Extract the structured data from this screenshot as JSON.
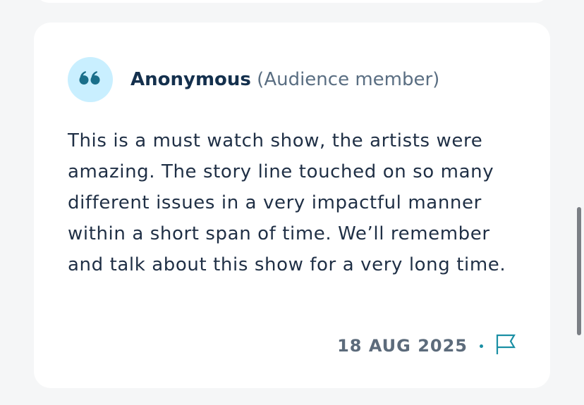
{
  "review": {
    "avatar_icon": "quote-icon",
    "author_name": "Anonymous",
    "author_role": "(Audience member)",
    "text": "This is a must watch show, the artists were amazing. The story line touched on so many different issues in a very impactful manner within a short span of time. We’ll remember and talk about this show for a very long time.",
    "date": "18 AUG 2025",
    "separator": "•",
    "report_icon": "flag-icon"
  },
  "colors": {
    "background": "#f5f6f7",
    "card": "#ffffff",
    "avatar_bg": "#c9efff",
    "accent": "#1a8fa4",
    "author_name": "#14304d",
    "author_role": "#5a6e82",
    "body_text": "#1f2f45",
    "date_text": "#5c6b7b",
    "scrollbar_thumb": "#7b7f85"
  }
}
